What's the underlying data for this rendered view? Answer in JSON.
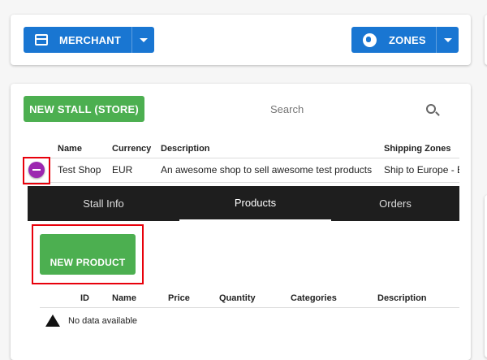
{
  "toolbar": {
    "merchant_label": "MERCHANT",
    "zones_label": "ZONES"
  },
  "stalls": {
    "new_stall_label": "NEW STALL (STORE)",
    "search_placeholder": "Search",
    "columns": [
      "Name",
      "Currency",
      "Description",
      "Shipping Zones"
    ],
    "rows": [
      {
        "name": "Test Shop",
        "currency": "EUR",
        "description": "An awesome shop to sell awesome test products",
        "shipping_zones": "Ship to Europe - E"
      }
    ]
  },
  "tabs": [
    {
      "label": "Stall Info"
    },
    {
      "label": "Products",
      "active": true
    },
    {
      "label": "Orders"
    }
  ],
  "products": {
    "new_product_label": "NEW PRODUCT",
    "columns": [
      "ID",
      "Name",
      "Price",
      "Quantity",
      "Categories",
      "Description"
    ],
    "empty_text": "No data available"
  },
  "colors": {
    "primary": "#1976d2",
    "positive": "#4caf50",
    "expand": "#9c27b0",
    "highlight": "#e8000b"
  }
}
